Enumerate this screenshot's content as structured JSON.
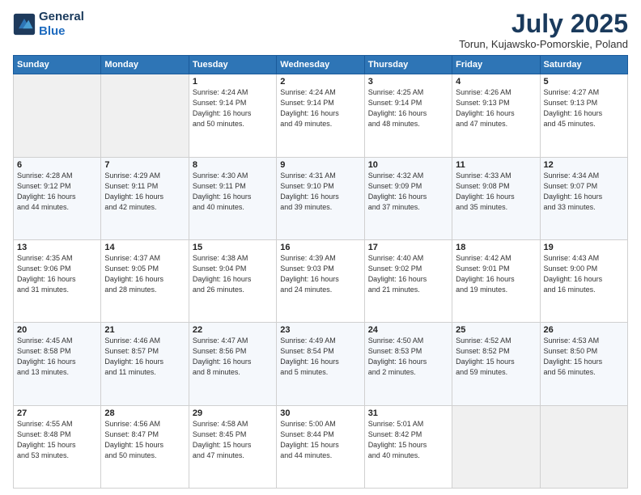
{
  "logo": {
    "line1": "General",
    "line2": "Blue"
  },
  "header": {
    "title": "July 2025",
    "subtitle": "Torun, Kujawsko-Pomorskie, Poland"
  },
  "columns": [
    "Sunday",
    "Monday",
    "Tuesday",
    "Wednesday",
    "Thursday",
    "Friday",
    "Saturday"
  ],
  "weeks": [
    {
      "days": [
        {
          "num": "",
          "info": "",
          "empty": true
        },
        {
          "num": "",
          "info": "",
          "empty": true
        },
        {
          "num": "1",
          "info": "Sunrise: 4:24 AM\nSunset: 9:14 PM\nDaylight: 16 hours\nand 50 minutes."
        },
        {
          "num": "2",
          "info": "Sunrise: 4:24 AM\nSunset: 9:14 PM\nDaylight: 16 hours\nand 49 minutes."
        },
        {
          "num": "3",
          "info": "Sunrise: 4:25 AM\nSunset: 9:14 PM\nDaylight: 16 hours\nand 48 minutes."
        },
        {
          "num": "4",
          "info": "Sunrise: 4:26 AM\nSunset: 9:13 PM\nDaylight: 16 hours\nand 47 minutes."
        },
        {
          "num": "5",
          "info": "Sunrise: 4:27 AM\nSunset: 9:13 PM\nDaylight: 16 hours\nand 45 minutes."
        }
      ]
    },
    {
      "days": [
        {
          "num": "6",
          "info": "Sunrise: 4:28 AM\nSunset: 9:12 PM\nDaylight: 16 hours\nand 44 minutes."
        },
        {
          "num": "7",
          "info": "Sunrise: 4:29 AM\nSunset: 9:11 PM\nDaylight: 16 hours\nand 42 minutes."
        },
        {
          "num": "8",
          "info": "Sunrise: 4:30 AM\nSunset: 9:11 PM\nDaylight: 16 hours\nand 40 minutes."
        },
        {
          "num": "9",
          "info": "Sunrise: 4:31 AM\nSunset: 9:10 PM\nDaylight: 16 hours\nand 39 minutes."
        },
        {
          "num": "10",
          "info": "Sunrise: 4:32 AM\nSunset: 9:09 PM\nDaylight: 16 hours\nand 37 minutes."
        },
        {
          "num": "11",
          "info": "Sunrise: 4:33 AM\nSunset: 9:08 PM\nDaylight: 16 hours\nand 35 minutes."
        },
        {
          "num": "12",
          "info": "Sunrise: 4:34 AM\nSunset: 9:07 PM\nDaylight: 16 hours\nand 33 minutes."
        }
      ]
    },
    {
      "days": [
        {
          "num": "13",
          "info": "Sunrise: 4:35 AM\nSunset: 9:06 PM\nDaylight: 16 hours\nand 31 minutes."
        },
        {
          "num": "14",
          "info": "Sunrise: 4:37 AM\nSunset: 9:05 PM\nDaylight: 16 hours\nand 28 minutes."
        },
        {
          "num": "15",
          "info": "Sunrise: 4:38 AM\nSunset: 9:04 PM\nDaylight: 16 hours\nand 26 minutes."
        },
        {
          "num": "16",
          "info": "Sunrise: 4:39 AM\nSunset: 9:03 PM\nDaylight: 16 hours\nand 24 minutes."
        },
        {
          "num": "17",
          "info": "Sunrise: 4:40 AM\nSunset: 9:02 PM\nDaylight: 16 hours\nand 21 minutes."
        },
        {
          "num": "18",
          "info": "Sunrise: 4:42 AM\nSunset: 9:01 PM\nDaylight: 16 hours\nand 19 minutes."
        },
        {
          "num": "19",
          "info": "Sunrise: 4:43 AM\nSunset: 9:00 PM\nDaylight: 16 hours\nand 16 minutes."
        }
      ]
    },
    {
      "days": [
        {
          "num": "20",
          "info": "Sunrise: 4:45 AM\nSunset: 8:58 PM\nDaylight: 16 hours\nand 13 minutes."
        },
        {
          "num": "21",
          "info": "Sunrise: 4:46 AM\nSunset: 8:57 PM\nDaylight: 16 hours\nand 11 minutes."
        },
        {
          "num": "22",
          "info": "Sunrise: 4:47 AM\nSunset: 8:56 PM\nDaylight: 16 hours\nand 8 minutes."
        },
        {
          "num": "23",
          "info": "Sunrise: 4:49 AM\nSunset: 8:54 PM\nDaylight: 16 hours\nand 5 minutes."
        },
        {
          "num": "24",
          "info": "Sunrise: 4:50 AM\nSunset: 8:53 PM\nDaylight: 16 hours\nand 2 minutes."
        },
        {
          "num": "25",
          "info": "Sunrise: 4:52 AM\nSunset: 8:52 PM\nDaylight: 15 hours\nand 59 minutes."
        },
        {
          "num": "26",
          "info": "Sunrise: 4:53 AM\nSunset: 8:50 PM\nDaylight: 15 hours\nand 56 minutes."
        }
      ]
    },
    {
      "days": [
        {
          "num": "27",
          "info": "Sunrise: 4:55 AM\nSunset: 8:48 PM\nDaylight: 15 hours\nand 53 minutes."
        },
        {
          "num": "28",
          "info": "Sunrise: 4:56 AM\nSunset: 8:47 PM\nDaylight: 15 hours\nand 50 minutes."
        },
        {
          "num": "29",
          "info": "Sunrise: 4:58 AM\nSunset: 8:45 PM\nDaylight: 15 hours\nand 47 minutes."
        },
        {
          "num": "30",
          "info": "Sunrise: 5:00 AM\nSunset: 8:44 PM\nDaylight: 15 hours\nand 44 minutes."
        },
        {
          "num": "31",
          "info": "Sunrise: 5:01 AM\nSunset: 8:42 PM\nDaylight: 15 hours\nand 40 minutes."
        },
        {
          "num": "",
          "info": "",
          "empty": true
        },
        {
          "num": "",
          "info": "",
          "empty": true
        }
      ]
    }
  ]
}
